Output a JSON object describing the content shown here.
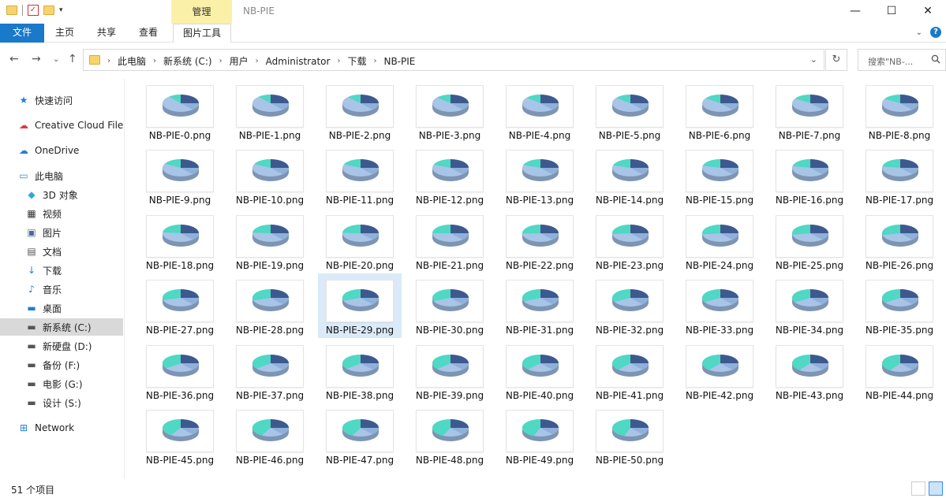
{
  "window": {
    "title": "NB-PIE",
    "context_tab": "管理",
    "controls": [
      "—",
      "☐",
      "✕"
    ]
  },
  "ribbon": {
    "tabs": [
      "文件",
      "主页",
      "共享",
      "查看",
      "图片工具"
    ]
  },
  "address": {
    "path": [
      "此电脑",
      "新系统 (C:)",
      "用户",
      "Administrator",
      "下载",
      "NB-PIE"
    ],
    "search_placeholder": "搜索\"NB-..."
  },
  "sidebar": {
    "items": [
      {
        "label": "快速访问",
        "icon": "star-icon"
      },
      {
        "label": "Creative Cloud Files",
        "icon": "creative-cloud-icon"
      },
      {
        "label": "OneDrive",
        "icon": "cloud-icon"
      },
      {
        "label": "此电脑",
        "icon": "computer-icon"
      },
      {
        "label": "3D 对象",
        "icon": "cube-icon"
      },
      {
        "label": "视频",
        "icon": "video-icon"
      },
      {
        "label": "图片",
        "icon": "picture-icon"
      },
      {
        "label": "文档",
        "icon": "document-icon"
      },
      {
        "label": "下载",
        "icon": "download-icon"
      },
      {
        "label": "音乐",
        "icon": "music-icon"
      },
      {
        "label": "桌面",
        "icon": "desktop-icon"
      },
      {
        "label": "新系统 (C:)",
        "icon": "drive-icon"
      },
      {
        "label": "新硬盘 (D:)",
        "icon": "drive-icon"
      },
      {
        "label": "备份 (F:)",
        "icon": "drive-icon"
      },
      {
        "label": "电影 (G:)",
        "icon": "drive-icon"
      },
      {
        "label": "设计 (S:)",
        "icon": "drive-icon"
      },
      {
        "label": "Network",
        "icon": "network-icon"
      }
    ],
    "selected": "新系统 (C:)"
  },
  "files": [
    "NB-PIE-0.png",
    "NB-PIE-1.png",
    "NB-PIE-2.png",
    "NB-PIE-3.png",
    "NB-PIE-4.png",
    "NB-PIE-5.png",
    "NB-PIE-6.png",
    "NB-PIE-7.png",
    "NB-PIE-8.png",
    "NB-PIE-9.png",
    "NB-PIE-10.png",
    "NB-PIE-11.png",
    "NB-PIE-12.png",
    "NB-PIE-13.png",
    "NB-PIE-14.png",
    "NB-PIE-15.png",
    "NB-PIE-16.png",
    "NB-PIE-17.png",
    "NB-PIE-18.png",
    "NB-PIE-19.png",
    "NB-PIE-20.png",
    "NB-PIE-21.png",
    "NB-PIE-22.png",
    "NB-PIE-23.png",
    "NB-PIE-24.png",
    "NB-PIE-25.png",
    "NB-PIE-26.png",
    "NB-PIE-27.png",
    "NB-PIE-28.png",
    "NB-PIE-29.png",
    "NB-PIE-30.png",
    "NB-PIE-31.png",
    "NB-PIE-32.png",
    "NB-PIE-33.png",
    "NB-PIE-34.png",
    "NB-PIE-35.png",
    "NB-PIE-36.png",
    "NB-PIE-37.png",
    "NB-PIE-38.png",
    "NB-PIE-39.png",
    "NB-PIE-40.png",
    "NB-PIE-41.png",
    "NB-PIE-42.png",
    "NB-PIE-43.png",
    "NB-PIE-44.png",
    "NB-PIE-45.png",
    "NB-PIE-46.png",
    "NB-PIE-47.png",
    "NB-PIE-48.png",
    "NB-PIE-49.png",
    "NB-PIE-50.png"
  ],
  "selected_file": "NB-PIE-29.png",
  "status": {
    "count": "51 个项目"
  },
  "colors": {
    "accent": "#1979ca",
    "context_tab": "#fbf0a8",
    "selection": "#dbeaf8",
    "pie_dark": "#3d5a8f",
    "pie_teal": "#4fd8c4",
    "pie_light": "#a8c4e6"
  }
}
